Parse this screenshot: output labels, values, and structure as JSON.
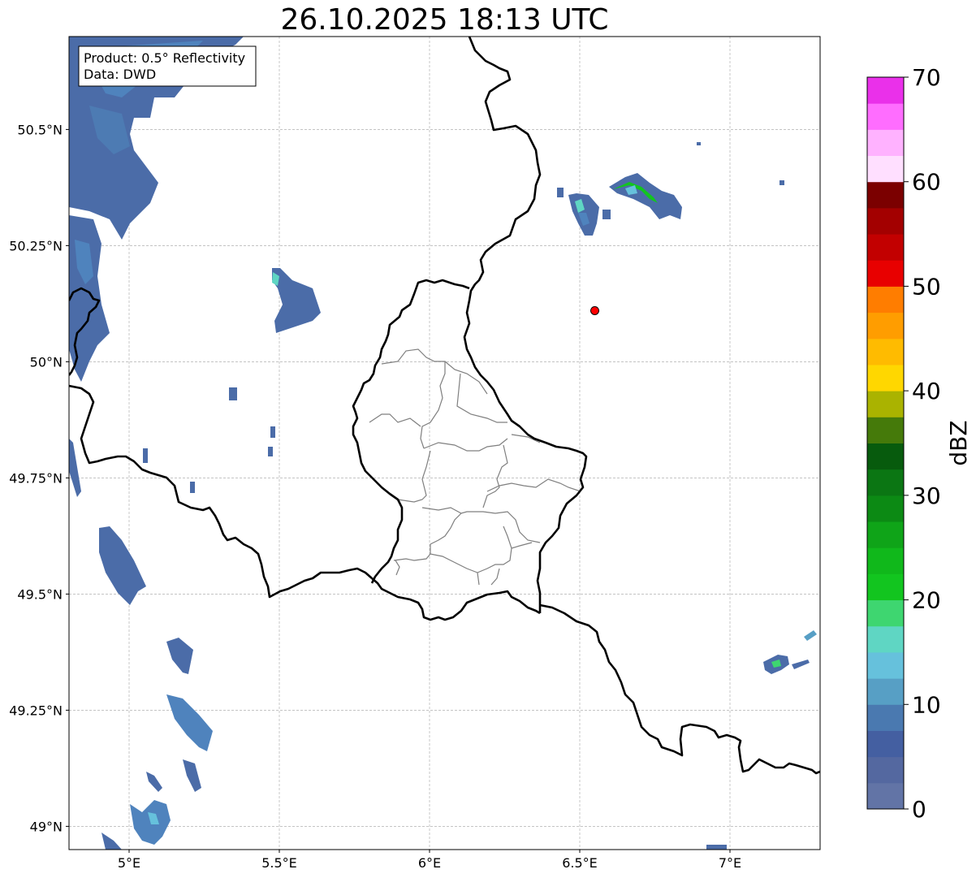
{
  "title": "26.10.2025 18:13 UTC",
  "info_box": {
    "product": "Product: 0.5° Reflectivity",
    "data": "Data: DWD"
  },
  "map": {
    "lon_range": [
      4.8,
      7.3
    ],
    "lat_range": [
      48.95,
      50.7
    ],
    "lon_ticks": [
      {
        "value": 5.0,
        "label": "5°E"
      },
      {
        "value": 5.5,
        "label": "5.5°E"
      },
      {
        "value": 6.0,
        "label": "6°E"
      },
      {
        "value": 6.5,
        "label": "6.5°E"
      },
      {
        "value": 7.0,
        "label": "7°E"
      }
    ],
    "lat_ticks": [
      {
        "value": 49.0,
        "label": "49°N"
      },
      {
        "value": 49.25,
        "label": "49.25°N"
      },
      {
        "value": 49.5,
        "label": "49.5°N"
      },
      {
        "value": 49.75,
        "label": "49.75°N"
      },
      {
        "value": 50.0,
        "label": "50°N"
      },
      {
        "value": 50.25,
        "label": "50.25°N"
      },
      {
        "value": 50.5,
        "label": "50.5°N"
      }
    ],
    "grid": true,
    "radar_site": {
      "lon": 6.55,
      "lat": 50.11,
      "color": "#ff0000"
    }
  },
  "colorbar": {
    "label": "dBZ",
    "min": 0,
    "max": 70,
    "ticks": [
      {
        "value": 0,
        "label": "0"
      },
      {
        "value": 10,
        "label": "10"
      },
      {
        "value": 20,
        "label": "20"
      },
      {
        "value": 30,
        "label": "30"
      },
      {
        "value": 40,
        "label": "40"
      },
      {
        "value": 50,
        "label": "50"
      },
      {
        "value": 60,
        "label": "60"
      },
      {
        "value": 70,
        "label": "70"
      }
    ],
    "colors": [
      "#6274a6",
      "#5468a0",
      "#445fa1",
      "#4a79b0",
      "#579fc5",
      "#66c1dc",
      "#5fd6c3",
      "#3ed670",
      "#12c51f",
      "#10b81b",
      "#0fa418",
      "#0c8a14",
      "#0b7613",
      "#075b0d",
      "#457a0a",
      "#aab300",
      "#ffd700",
      "#ffbb00",
      "#ff9d00",
      "#ff7d00",
      "#e80000",
      "#c20000",
      "#a30000",
      "#7b0000",
      "#ffdfff",
      "#ffb2ff",
      "#ff6dff",
      "#ea30ea"
    ]
  }
}
